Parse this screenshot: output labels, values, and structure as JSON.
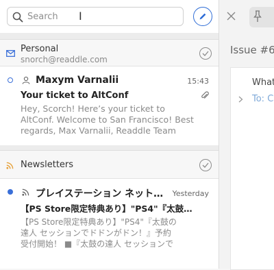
{
  "search": {
    "placeholder": "Search"
  },
  "groups": [
    {
      "title": "Personal",
      "subtitle": "snorch@readdle.com"
    },
    {
      "title": "Newsletters"
    }
  ],
  "messages": [
    {
      "sender": "Maxym Varnalii",
      "time": "15:43",
      "subject": "Your ticket to AltConf",
      "preview_lines": [
        "Hey, Scorch! Here’s your ticket to",
        "AltConf. Welcome to San Francisco! Best",
        "regards, Max Varnalii, Readdle Team"
      ]
    },
    {
      "sender": "プレイステーション ネット…",
      "time": "Yesterday",
      "subject": "【PS Store限定特典あり】\"PS4\"『太鼓…",
      "preview_lines": [
        "【PS Store限定特典あり】\"PS4\"『太鼓の",
        "達人 セッションでドドンがドン！』予約",
        "受付開始！ ■『太鼓の達人 セッションで"
      ]
    }
  ],
  "detail": {
    "title": "Issue #6",
    "line1": "What",
    "line2": "To: C"
  },
  "colors": {
    "accent": "#2d6cd6",
    "unread": "#3a6fd8",
    "newsletter_icon": "#e6a23c",
    "mail_icon": "#3a6fd8"
  }
}
